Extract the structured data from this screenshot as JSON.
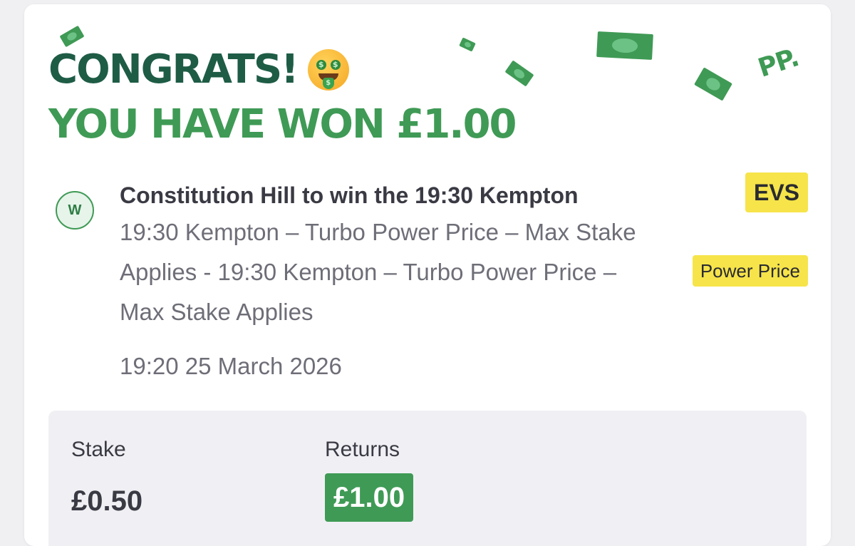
{
  "header": {
    "congrats": "CONGRATS!",
    "won_text": "YOU HAVE WON £1.00",
    "emoji": "money-mouth-face-icon",
    "brand_mark": "PP."
  },
  "selection": {
    "status": "W",
    "title": "Constitution Hill to win the 19:30 Kempton",
    "description": "19:30 Kempton – Turbo Power Price – Max Stake Applies - 19:30 Kempton – Turbo Power Price – Max Stake Applies",
    "datetime": "19:20 25 March 2026",
    "odds": "EVS",
    "price_tag": "Power Price"
  },
  "summary": {
    "stake_label": "Stake",
    "stake_value": "£0.50",
    "returns_label": "Returns",
    "returns_value": "£1.00"
  },
  "colors": {
    "brand_dark_green": "#1e5c46",
    "brand_green": "#3f9a55",
    "badge_yellow": "#f6e44a"
  }
}
